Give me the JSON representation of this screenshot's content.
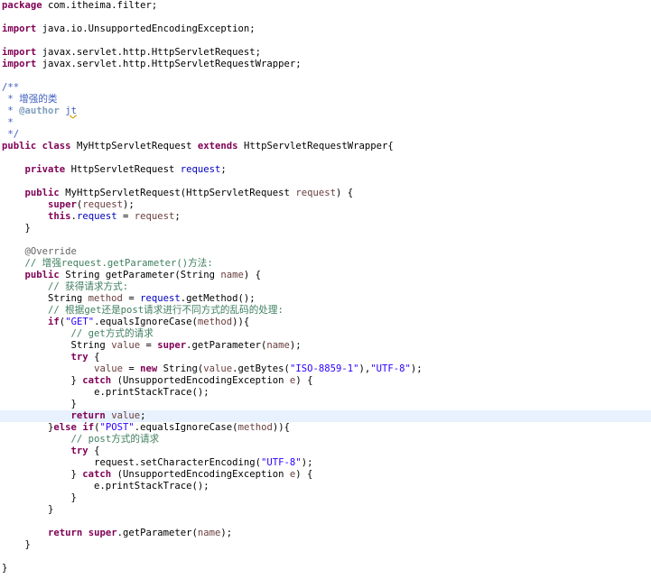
{
  "code": {
    "package_line": "package com.itheima.filter;",
    "import_1": "import java.io.UnsupportedEncodingException;",
    "import_2": "import javax.servlet.http.HttpServletRequest;",
    "import_3": "import javax.servlet.http.HttpServletRequestWrapper;",
    "javadoc_open": "/**",
    "javadoc_desc": " * 增强的类",
    "javadoc_author_tag": "@author",
    "javadoc_author_name": "jt",
    "javadoc_star": " *",
    "javadoc_close": " */",
    "class_name": "MyHttpServletRequest",
    "super_class": "HttpServletRequestWrapper{",
    "field_type": "HttpServletRequest",
    "field_name": "request",
    "constructor_name": "MyHttpServletRequest(HttpServletRequest ",
    "constructor_param": "request",
    "annotation": "@Override",
    "comment_enhance": "// 增强request.getParameter()方法:",
    "method_sig": "String getParameter(String ",
    "method_param": "name",
    "comment_get_method": "// 获得请求方式:",
    "var_method": "method",
    "comment_branch": "// 根据get还是post请求进行不同方式的乱码的处理:",
    "str_get": "\"GET\"",
    "comment_get": "// get方式的请求",
    "var_value": "value",
    "str_iso": "\"ISO-8859-1\"",
    "str_utf8": "\"UTF-8\"",
    "exception": "UnsupportedEncodingException ",
    "var_e": "e",
    "print_stack": "e.printStackTrace();",
    "str_post": "\"POST\"",
    "comment_post": "// post方式的请求",
    "set_encoding": "request.setCharacterEncoding(",
    "get_param_call": ".getParameter("
  }
}
